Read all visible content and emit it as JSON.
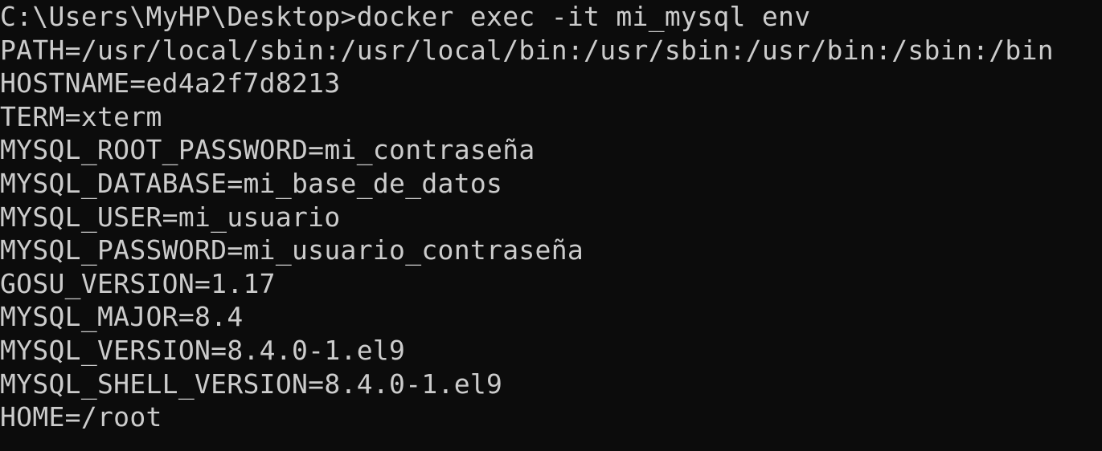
{
  "colors": {
    "background": "#0c0c0c",
    "text": "#cccccc"
  },
  "terminal": {
    "prompt": "C:\\Users\\MyHP\\Desktop>",
    "command": "docker exec -it mi_mysql env",
    "output": [
      "PATH=/usr/local/sbin:/usr/local/bin:/usr/sbin:/usr/bin:/sbin:/bin",
      "HOSTNAME=ed4a2f7d8213",
      "TERM=xterm",
      "MYSQL_ROOT_PASSWORD=mi_contraseña",
      "MYSQL_DATABASE=mi_base_de_datos",
      "MYSQL_USER=mi_usuario",
      "MYSQL_PASSWORD=mi_usuario_contraseña",
      "GOSU_VERSION=1.17",
      "MYSQL_MAJOR=8.4",
      "MYSQL_VERSION=8.4.0-1.el9",
      "MYSQL_SHELL_VERSION=8.4.0-1.el9",
      "HOME=/root"
    ]
  }
}
